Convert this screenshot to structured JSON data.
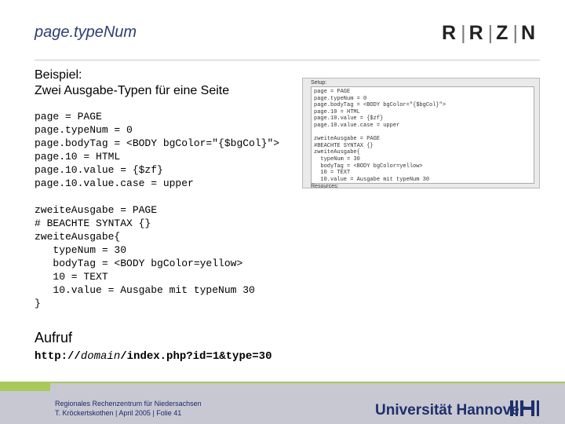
{
  "header": {
    "title": "page.typeNum",
    "logo": [
      "R",
      "R",
      "Z",
      "N"
    ]
  },
  "intro": {
    "line1": "Beispiel:",
    "line2": "Zwei Ausgabe-Typen für eine Seite"
  },
  "code": {
    "block1": "page = PAGE\npage.typeNum = 0\npage.bodyTag = <BODY bgColor=\"{$bgCol}\">\npage.10 = HTML\npage.10.value = {$zf}\npage.10.value.case = upper",
    "block2": "zweiteAusgabe = PAGE\n# BEACHTE SYNTAX {}\nzweiteAusgabe{\n   typeNum = 30\n   bodyTag = <BODY bgColor=yellow>\n   10 = TEXT\n   10.value = Ausgabe mit typeNum 30\n}"
  },
  "screenshot": {
    "setup_label": "Setup:",
    "code": "page = PAGE\npage.typeNum = 0\npage.bodyTag = <BODY bgColor=\"{$bgCol}\">\npage.10 = HTML\npage.10.value = {$zf}\npage.10.value.case = upper\n\nzweiteAusgabe = PAGE\n#BEACHTE SYNTAX {}\nzweiteAusgabe{\n  typeNum = 30\n  bodyTag = <BODY bgColor=yellow>\n  10 = TEXT\n  10.value = Ausgabe mit typeNum 30\n}",
    "resources_label": "Resources:"
  },
  "aufruf": {
    "heading": "Aufruf",
    "url_prefix": "http://",
    "url_domain": "domain",
    "url_suffix": "/index.php?id=1&type=30"
  },
  "footer": {
    "line1": "Regionales Rechenzentrum für Niedersachsen",
    "line2": "T. Kröckertskothen | April 2005 | Folie 41",
    "university": "Universität Hannover",
    "colors": {
      "bar": "#c8c8d2",
      "accent": "#a9c95c",
      "brand": "#1e2f6b"
    }
  }
}
